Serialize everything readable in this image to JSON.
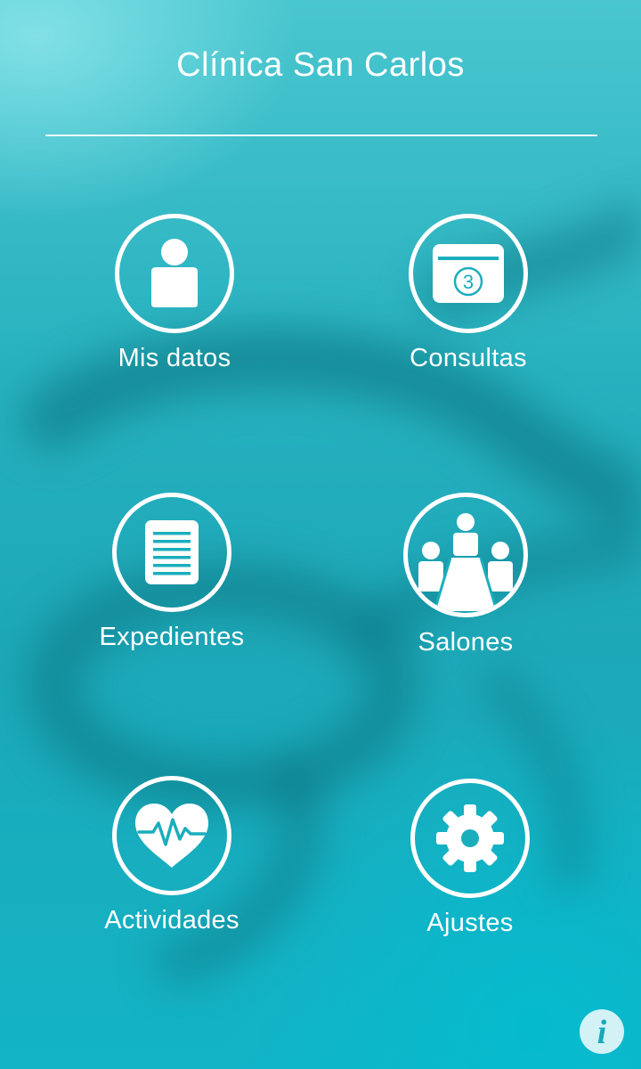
{
  "app": {
    "title": "Clínica San Carlos"
  },
  "menu": {
    "items": [
      {
        "label": "Mis datos",
        "icon": "user-icon"
      },
      {
        "label": "Consultas",
        "icon": "calendar-icon",
        "badge": "3"
      },
      {
        "label": "Expedientes",
        "icon": "document-icon"
      },
      {
        "label": "Salones",
        "icon": "meeting-room-icon"
      },
      {
        "label": "Actividades",
        "icon": "heartbeat-icon"
      },
      {
        "label": "Ajustes",
        "icon": "gear-icon"
      }
    ]
  },
  "info_button": {
    "glyph": "i",
    "icon": "info-icon"
  },
  "colors": {
    "background": "#1aaebd",
    "foreground": "#ffffff",
    "accent": "#18a9bb"
  }
}
